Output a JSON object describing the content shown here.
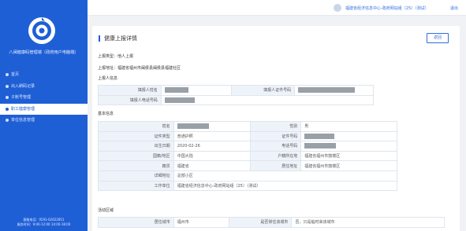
{
  "app": {
    "title": "八闽健康码管理端（政府用户电脑端）",
    "footer_line1": "客服电话：0591-62622851",
    "footer_line2": "服务时间：9:00-12:00 14:00-18:00"
  },
  "nav": {
    "items": [
      {
        "label": "首页",
        "active": false
      },
      {
        "label": "出入刷码记录",
        "active": false
      },
      {
        "label": "子账号管理",
        "active": false
      },
      {
        "label": "职工健康管理",
        "active": true
      },
      {
        "label": "单位信息管理",
        "active": false
      }
    ]
  },
  "topbar": {
    "user": "福建省经济信息中心-政府网站组（25）（测试）",
    "logout": "退出"
  },
  "page": {
    "title": "健康上报详情",
    "back_label": "返回",
    "report_type_label": "上报类型：",
    "report_type_value": "他人上报",
    "report_address_label": "上报地址：",
    "report_address_value": "福建省福州市闽侯县闽侯县福建社区"
  },
  "reporter": {
    "section": "上报人信息",
    "name_label": "填报人姓名",
    "id_label": "填报人证件号码",
    "phone_label": "填报人电话号码"
  },
  "basic": {
    "section": "基本信息",
    "name_label": "姓名",
    "gender_label": "性别",
    "gender_value": "男",
    "doc_type_label": "证件类型",
    "doc_type_value": "普通护照",
    "doc_no_label": "证件号码",
    "birth_label": "出生日期",
    "birth_value": "2020-02-26",
    "phone_label": "电话号码",
    "nation_label": "国籍/地区",
    "nation_value": "中国大陆",
    "household_label": "户籍所在地",
    "household_value": "福建省福州市鼓楼区",
    "origin_label": "籍贯",
    "origin_value": "福建省",
    "residence_label": "居住地址",
    "residence_value": "福建省福州市鼓楼区",
    "detail_label": "详细地址",
    "detail_value": "总部小区",
    "company_label": "工作单位",
    "company_value": "福建省经济信息中心-政府网站组（25）（测试）"
  },
  "activity": {
    "section": "活动区域",
    "city_label": "居住城市",
    "city_value": "福州市",
    "other_label": "是否常住该城市",
    "other_value": "否，只是临时来该城市"
  },
  "colors": {
    "sidebar": "#1f5fd6",
    "accent": "#2f6fe0",
    "label_bg": "#eef3fa",
    "mask": "#9aa0a8"
  }
}
